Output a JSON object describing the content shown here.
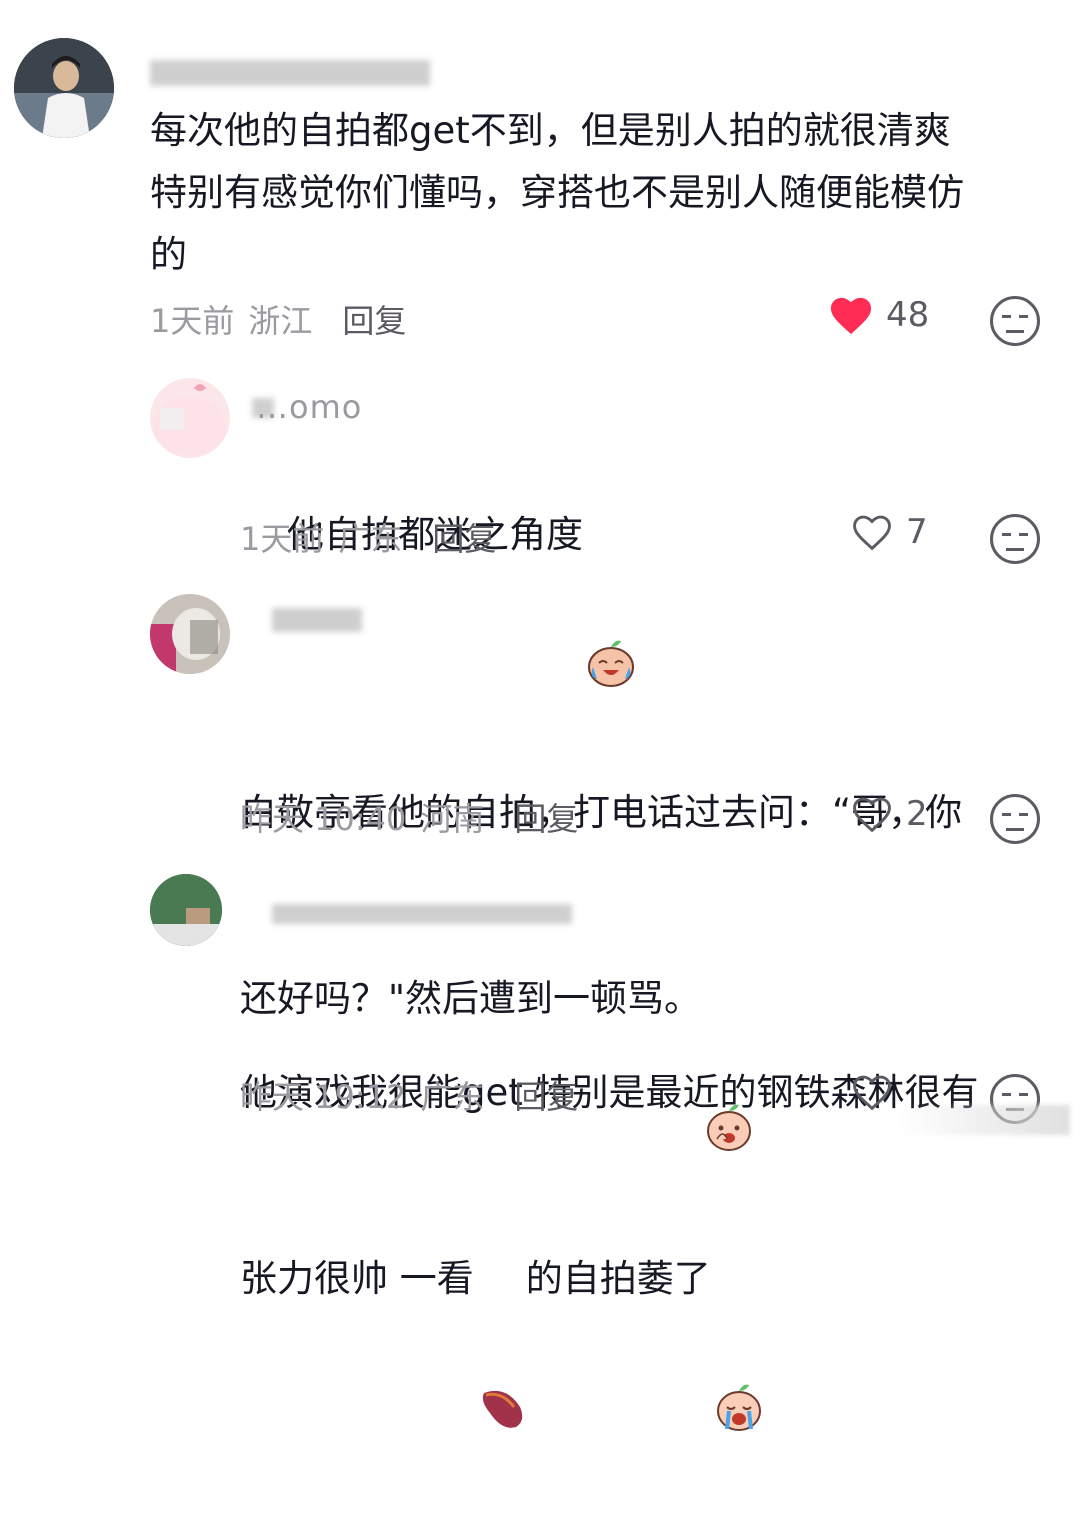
{
  "comments": [
    {
      "username": "",
      "text": "每次他的自拍都get不到，但是别人拍的就很清爽\n特别有感觉你们懂吗，穿搭也不是别人随便能模仿\n的",
      "time": "1天前",
      "location": "浙江",
      "reply_label": "回复",
      "likes": "48",
      "liked": true,
      "emoji_icon": "neutral-face-icon"
    },
    {
      "username": "…omo",
      "text": "他自拍都迷之角度",
      "time": "1天前",
      "location": "广东",
      "reply_label": "回复",
      "likes": "7",
      "liked": false,
      "emoji_icon": "neutral-face-icon"
    },
    {
      "username": "",
      "text_line1": "白敬亭看他的自拍，打电话过去问：“哥，你",
      "text_line2": "还好吗？\"然后遭到一顿骂。",
      "time": "昨天 10:40",
      "location": "河南",
      "reply_label": "回复",
      "likes": "2",
      "liked": false,
      "emoji_icon": "neutral-face-icon"
    },
    {
      "username": "",
      "text_line1": "他演戏我很能get 特别是最近的钢铁森林很有",
      "text_line2_a": "张力很帅 一看",
      "text_line2_b": "的自拍萎了",
      "time": "昨天 19:12",
      "location": "广东",
      "reply_label": "回复",
      "likes": "",
      "liked": false,
      "emoji_icon": "neutral-face-icon"
    }
  ],
  "colors": {
    "like_red": "#fe2c55",
    "meta_gray": "#9a9aa0",
    "text": "#161823"
  }
}
